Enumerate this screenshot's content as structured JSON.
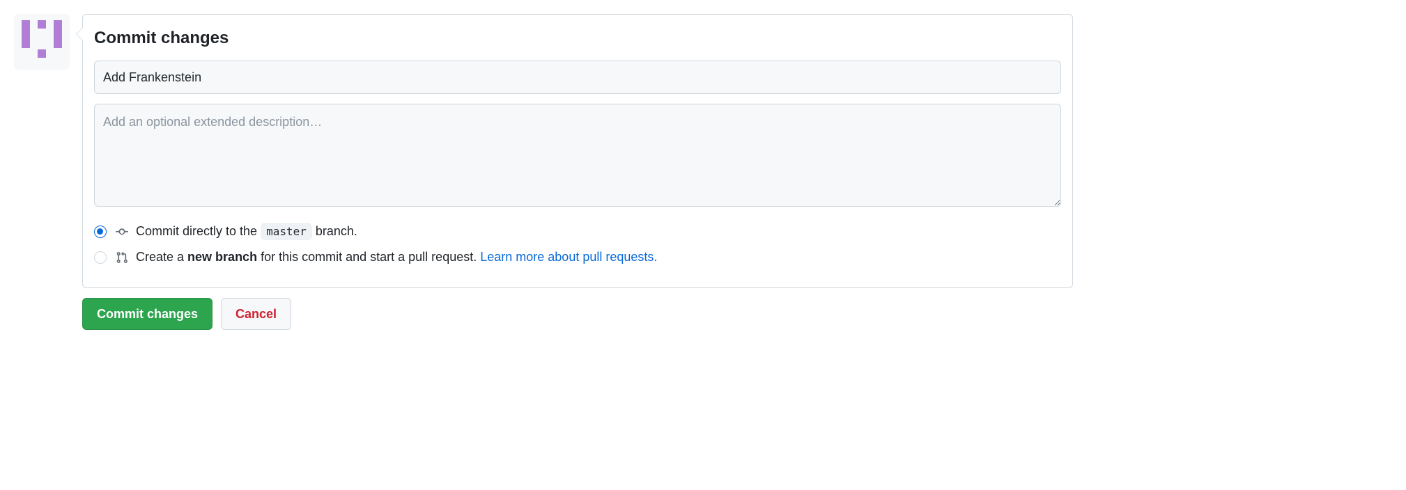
{
  "form": {
    "title": "Commit changes",
    "commit_message": "Add Frankenstein",
    "description_placeholder": "Add an optional extended description…",
    "description_value": "",
    "options": {
      "direct": {
        "prefix": "Commit directly to the ",
        "branch": "master",
        "suffix": " branch."
      },
      "new_branch": {
        "prefix": "Create a ",
        "bold": "new branch",
        "suffix": " for this commit and start a pull request. ",
        "link_text": "Learn more about pull requests."
      }
    },
    "buttons": {
      "commit": "Commit changes",
      "cancel": "Cancel"
    }
  }
}
